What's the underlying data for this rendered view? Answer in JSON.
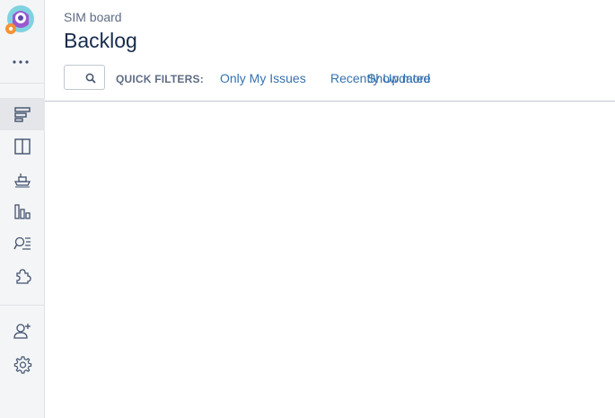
{
  "sidebar": {
    "logo_name": "project-avatar",
    "more_icon": "more-horizontal-icon",
    "nav": [
      {
        "id": "backlog",
        "icon": "backlog-icon",
        "active": true
      },
      {
        "id": "board",
        "icon": "board-icon",
        "active": false
      },
      {
        "id": "releases",
        "icon": "ship-icon",
        "active": false
      },
      {
        "id": "reports",
        "icon": "reports-icon",
        "active": false
      },
      {
        "id": "issues",
        "icon": "issues-search-icon",
        "active": false
      },
      {
        "id": "add-ons",
        "icon": "puzzle-icon",
        "active": false
      },
      {
        "id": "add-people",
        "icon": "add-user-icon",
        "active": false
      },
      {
        "id": "settings",
        "icon": "gear-icon",
        "active": false
      }
    ]
  },
  "header": {
    "breadcrumb": "SIM board",
    "title": "Backlog"
  },
  "filters": {
    "search_value": "",
    "label": "QUICK FILTERS:",
    "items": [
      "Only My Issues",
      "Recently Updated",
      "Show more"
    ]
  },
  "colors": {
    "link": "#3572b0",
    "sidebar_bg": "#f4f5f7",
    "title": "#172b4d",
    "muted": "#5e6c84"
  }
}
